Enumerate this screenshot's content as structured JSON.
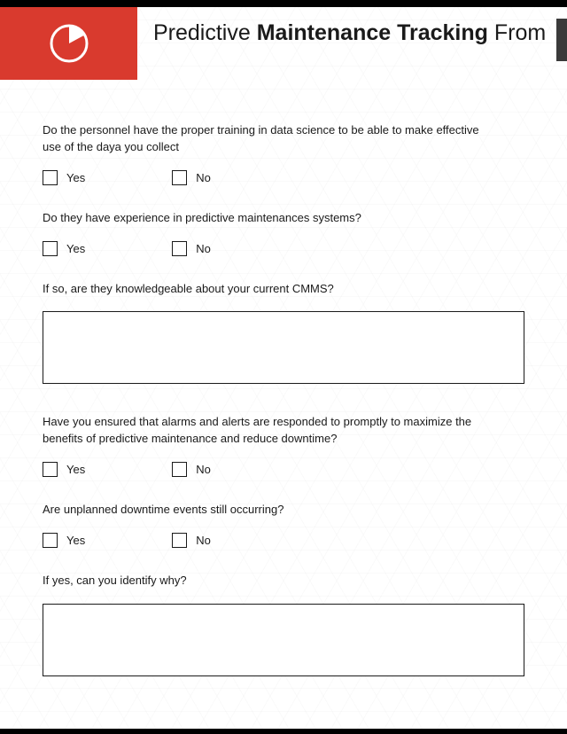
{
  "title": {
    "part1": "Predictive ",
    "part2_bold": "Maintenance Tracking",
    "part3": " From"
  },
  "questions": {
    "q1": {
      "text": "Do the personnel have the proper training in data science to be able to make effective use of the daya you collect",
      "opt_yes": "Yes",
      "opt_no": "No"
    },
    "q2": {
      "text": "Do they have experience in predictive maintenances systems?",
      "opt_yes": "Yes",
      "opt_no": "No"
    },
    "q3": {
      "text": "If so, are they knowledgeable about your current CMMS?"
    },
    "q4": {
      "text": "Have you ensured that alarms and alerts are responded to promptly to maximize the benefits of predictive maintenance and reduce downtime?",
      "opt_yes": "Yes",
      "opt_no": "No"
    },
    "q5": {
      "text": "Are unplanned downtime events still occurring?",
      "opt_yes": "Yes",
      "opt_no": "No"
    },
    "q6": {
      "text": "If yes, can you identify why?"
    }
  }
}
